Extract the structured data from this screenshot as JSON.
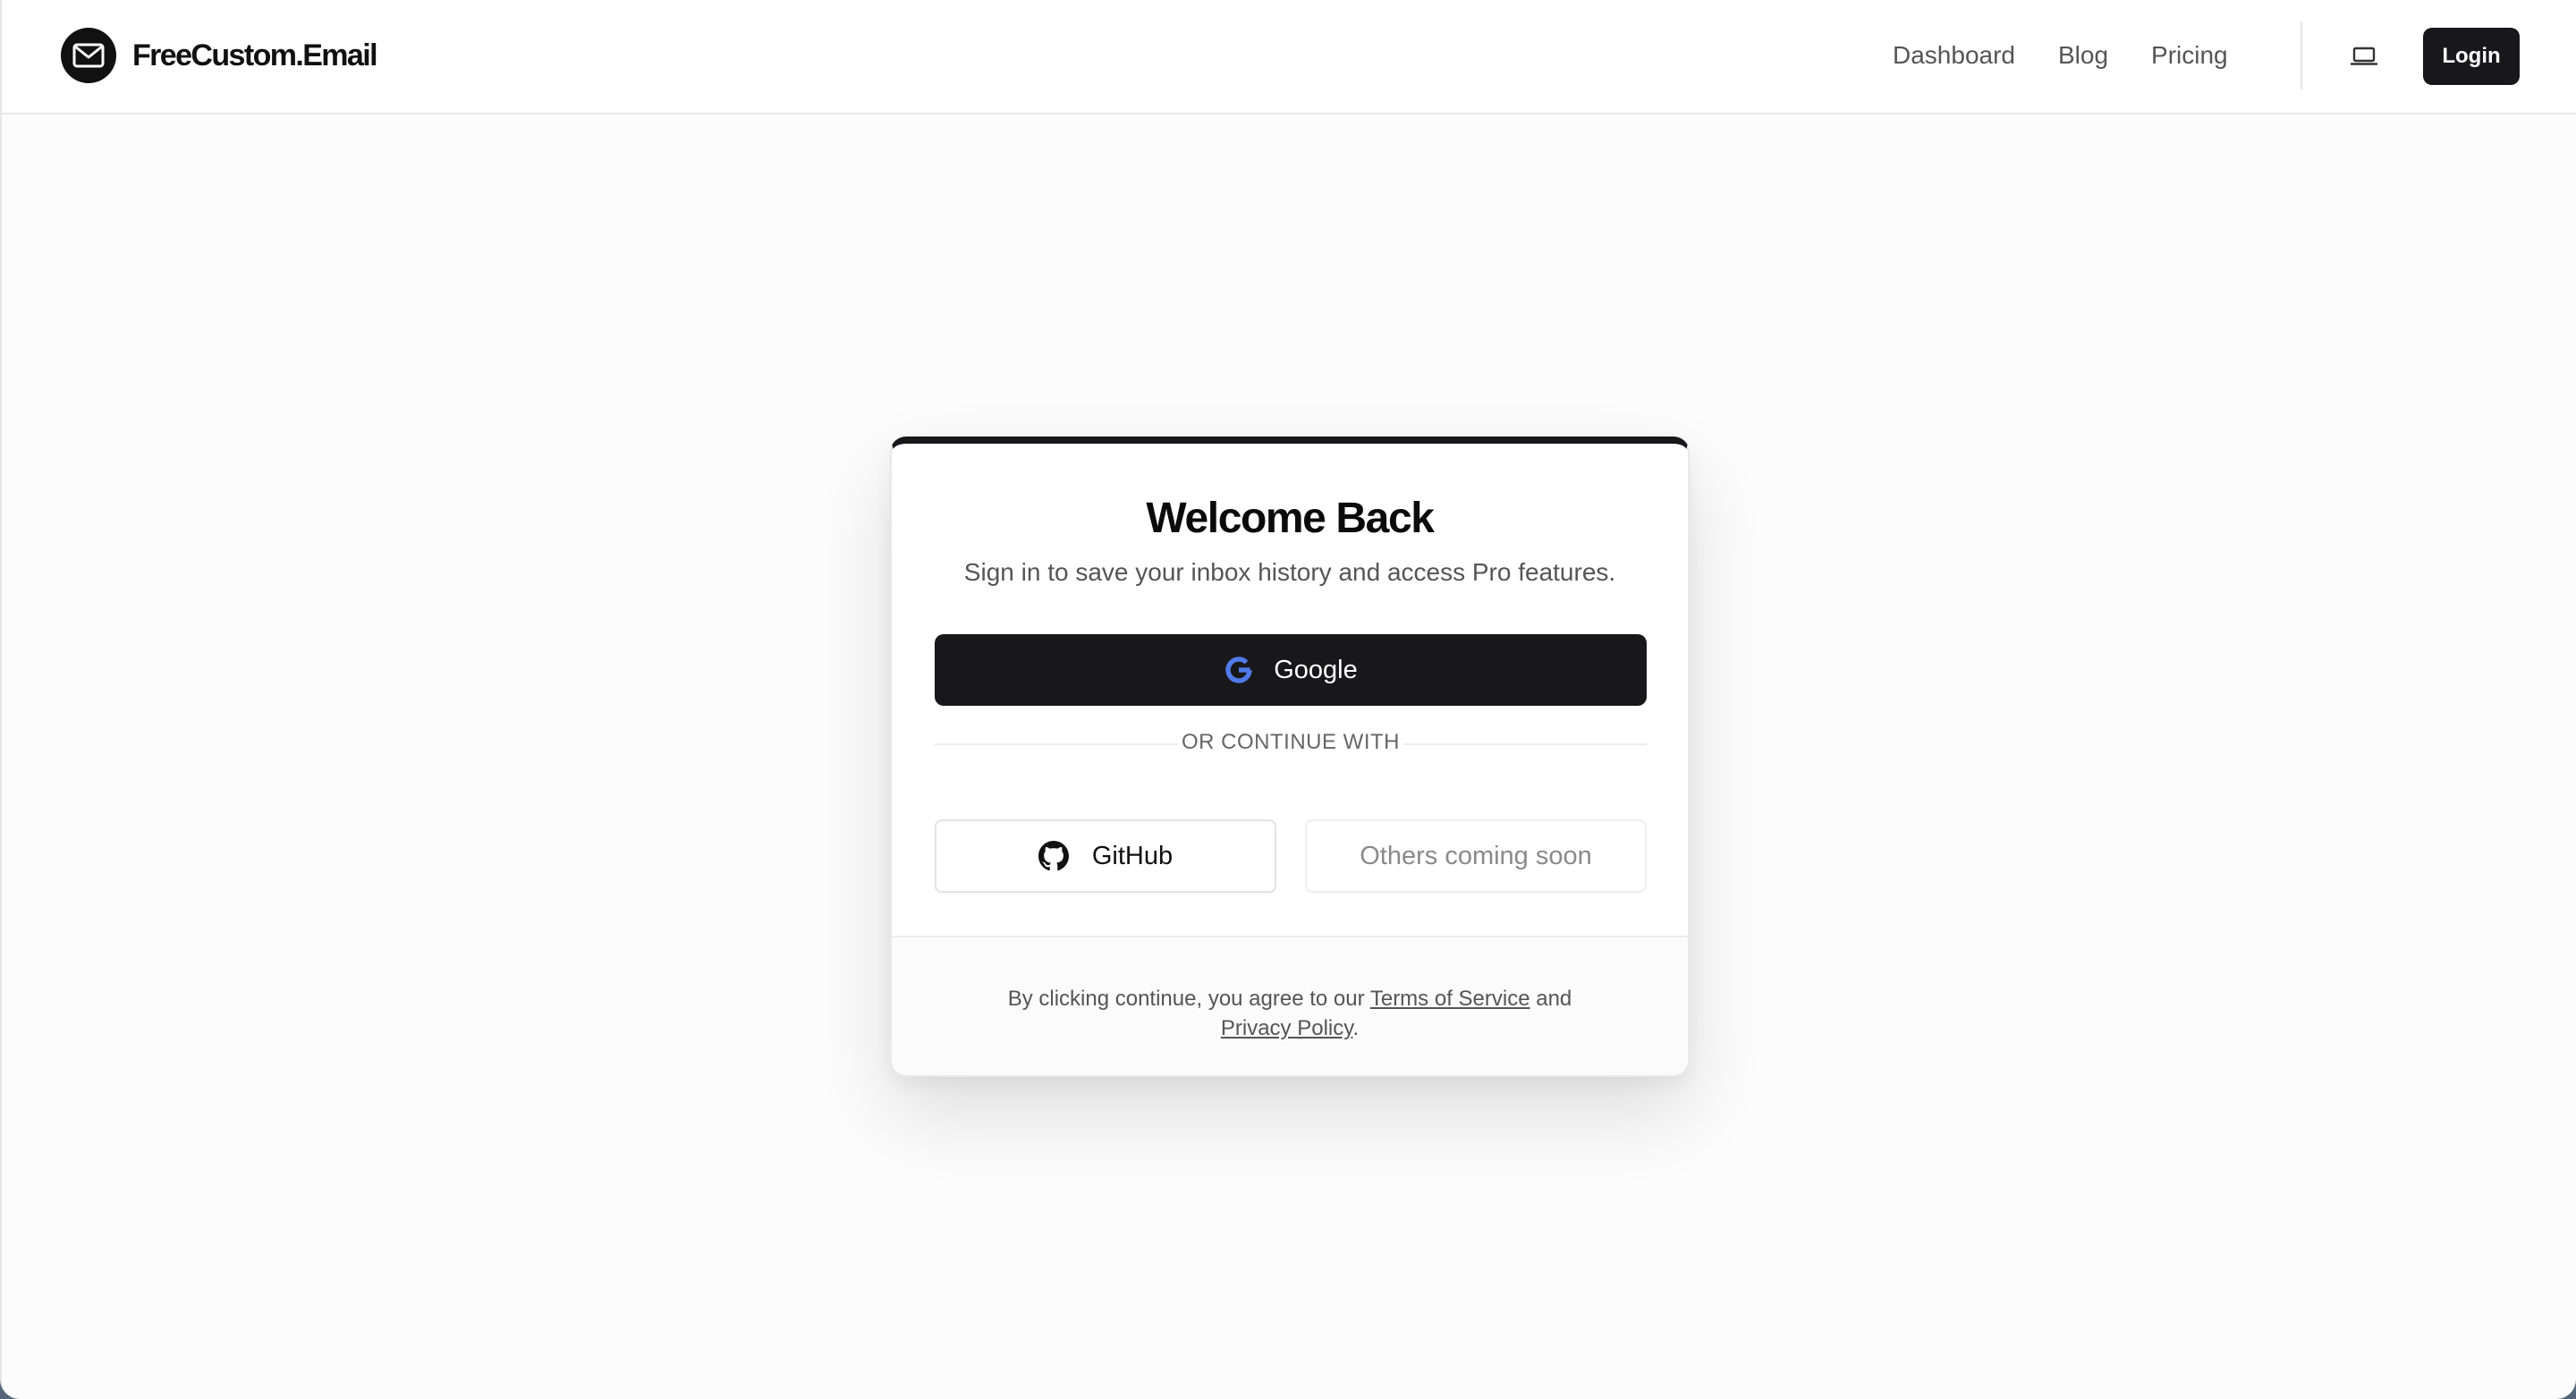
{
  "header": {
    "brand": "FreeCustom.Email",
    "nav": [
      {
        "label": "Dashboard"
      },
      {
        "label": "Blog"
      },
      {
        "label": "Pricing"
      }
    ],
    "theme_icon": "laptop-icon",
    "login_label": "Login"
  },
  "login": {
    "title": "Welcome Back",
    "subtitle": "Sign in to save your inbox history and access Pro features.",
    "google_label": "Google",
    "divider_label": "OR CONTINUE WITH",
    "github_label": "GitHub",
    "others_label": "Others coming soon",
    "terms": {
      "prefix": "By clicking continue, you agree to our ",
      "tos_label": "Terms of Service",
      "middle": " and",
      "privacy_label": "Privacy Policy",
      "suffix": "."
    }
  },
  "colors": {
    "primary": "#18181b",
    "google_icon": "#4f7ae8",
    "background": "#fcfcfc"
  }
}
